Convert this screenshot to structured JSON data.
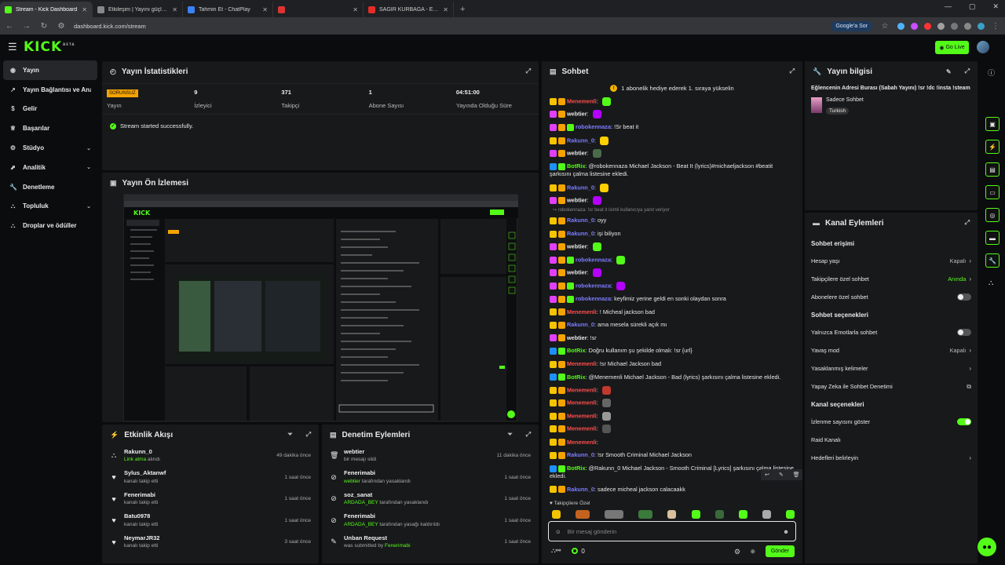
{
  "browser": {
    "tabs": [
      {
        "title": "Stream - Kick Dashboard",
        "color": "#53fc18"
      },
      {
        "title": "Etkileşim | Yayını güçlendir",
        "color": "#888888"
      },
      {
        "title": "Tahmin Et - ChatPlay",
        "color": "#3b82f6"
      },
      {
        "title": "",
        "color": "#d33"
      },
      {
        "title": "SAĞIR KURBAĞA - EĞLENCELİ V",
        "color": "#e52d27"
      }
    ],
    "url": "dashboard.kick.com/stream",
    "google_label": "Google'a Sor"
  },
  "topbar": {
    "logo": "KICK",
    "logo_sup": "BETA",
    "go_live": "Go Live"
  },
  "sidebar": {
    "items": [
      {
        "label": "Yayın",
        "icon": "home-icon",
        "chev": ""
      },
      {
        "label": "Yayın Bağlantısı ve Anahtarı",
        "icon": "link-icon",
        "chev": ""
      },
      {
        "label": "Gelir",
        "icon": "money-icon",
        "chev": ""
      },
      {
        "label": "Başarılar",
        "icon": "trophy-icon",
        "chev": ""
      },
      {
        "label": "Stüdyo",
        "icon": "settings-icon",
        "chev": "⌄"
      },
      {
        "label": "Analitik",
        "icon": "chart-icon",
        "chev": "⌄"
      },
      {
        "label": "Denetleme",
        "icon": "wrench-icon",
        "chev": ""
      },
      {
        "label": "Topluluk",
        "icon": "people-icon",
        "chev": "⌄"
      },
      {
        "label": "Droplar ve ödüller",
        "icon": "gift-icon",
        "chev": ""
      }
    ]
  },
  "stats_panel": {
    "title": "Yayın İstatistikleri",
    "offline_badge": "SORUNSUZ",
    "stats": [
      {
        "value": "",
        "label": "Yayın"
      },
      {
        "value": "9",
        "label": "İzleyici"
      },
      {
        "value": "371",
        "label": "Takipçi"
      },
      {
        "value": "1",
        "label": "Abone Sayısı"
      },
      {
        "value": "04:51:00",
        "label": "Yayında Olduğu Süre"
      }
    ],
    "status_msg": "Stream started successfully."
  },
  "preview_panel": {
    "title": "Yayın Ön İzlemesi"
  },
  "events_panel": {
    "title": "Etkinlik Akışı",
    "items": [
      {
        "name": "Rakunn_0",
        "sub": "Link atma",
        "sub2": " alındı",
        "time": "49 dakika önce",
        "icon": "⛬"
      },
      {
        "name": "Sylus_Aktanwf",
        "sub": "",
        "sub2": "kanalı takip etti",
        "time": "1 saat önce",
        "icon": "♥"
      },
      {
        "name": "Fenerimabi",
        "sub": "",
        "sub2": "kanalı takip etti",
        "time": "1 saat önce",
        "icon": "♥"
      },
      {
        "name": "Batu0978",
        "sub": "",
        "sub2": "kanalı takip etti",
        "time": "1 saat önce",
        "icon": "♥"
      },
      {
        "name": "NeymarJR32",
        "sub": "",
        "sub2": "kanalı takip etti",
        "time": "3 saat önce",
        "icon": "♥"
      }
    ]
  },
  "mod_panel": {
    "title": "Denetim Eylemleri",
    "items": [
      {
        "name": "webtier",
        "sub": "",
        "sub2": "bir mesajı sildi",
        "time": "11 dakika önce",
        "icon": "🗑"
      },
      {
        "name": "Fenerimabi",
        "sub": "webtier",
        "sub2": " tarafından yasaklandı",
        "time": "1 saat önce",
        "icon": "⊘"
      },
      {
        "name": "soz_sanat",
        "sub": "ARDADA_BEY",
        "sub2": " tarafından yasaklandı",
        "time": "1 saat önce",
        "icon": "⊘"
      },
      {
        "name": "Fenerimabi",
        "sub": "ARDADA_BEY",
        "sub2": " tarafından yasağı kaldırıldı",
        "time": "1 saat önce",
        "icon": "⊘"
      },
      {
        "name": "Unban Request",
        "sub": "",
        "sub2": "was submitted by ",
        "sub3": "Fenerimabi",
        "time": "1 saat önce",
        "icon": "✎"
      }
    ]
  },
  "chat_panel": {
    "title": "Sohbet",
    "banner": "1 abonelik hediye ederek 1. sıraya yükselin",
    "reply_note": "robokennaza: !sr beat it isimli kullanıcıya yanıt veriyor",
    "followers_only": "Takipçilere Özel",
    "input_placeholder": "Bir mesaj gönderin",
    "send_label": "Gönder",
    "viewer_count": "0",
    "messages": [
      {
        "user": "Menemenli",
        "color": "#ff4d4d",
        "text": "",
        "badges": [
          "#f5c400",
          "#f5a300"
        ],
        "emote": "#53fc18"
      },
      {
        "user": "webtier",
        "color": "#e8e8e8",
        "text": "",
        "badges": [
          "#e040fb",
          "#f5a300"
        ],
        "emote": "#b400ff"
      },
      {
        "user": "robokennaza",
        "color": "#7c7cff",
        "text": "!Sr beat it",
        "badges": [
          "#e040fb",
          "#f5a300",
          "#53fc18"
        ],
        "emote": ""
      },
      {
        "user": "Rakunn_0",
        "color": "#7c7cff",
        "text": "",
        "badges": [
          "#f5c400",
          "#f5a300"
        ],
        "emote": "#ffd000"
      },
      {
        "user": "webtier",
        "color": "#e8e8e8",
        "text": "",
        "badges": [
          "#e040fb",
          "#f5a300"
        ],
        "emote": "#4a6a4a"
      },
      {
        "user": "BotRix",
        "color": "#53fc18",
        "text": "@robokennaza Michael Jackson - Beat It (lyrics)#michaeljackson #beatit şarkısını çalma listesine ekledi.",
        "badges": [
          "#1e90ff",
          "#53fc18"
        ],
        "emote": "",
        "tall": true
      },
      {
        "user": "Rakunn_0",
        "color": "#7c7cff",
        "text": "",
        "badges": [
          "#f5c400",
          "#f5a300"
        ],
        "emote": "#ffd000"
      },
      {
        "user": "webtier",
        "color": "#e8e8e8",
        "text": "",
        "badges": [
          "#e040fb",
          "#f5a300"
        ],
        "emote": "#b400ff",
        "reply": true
      },
      {
        "user": "Rakunn_0",
        "color": "#7c7cff",
        "text": "oyy",
        "badges": [
          "#f5c400",
          "#f5a300"
        ],
        "emote": ""
      },
      {
        "user": "Rakunn_0",
        "color": "#7c7cff",
        "text": "işi biliyon",
        "badges": [
          "#f5c400",
          "#f5a300"
        ],
        "emote": ""
      },
      {
        "user": "webtier",
        "color": "#e8e8e8",
        "text": "",
        "badges": [
          "#e040fb",
          "#f5a300"
        ],
        "emote": "#53fc18"
      },
      {
        "user": "robokennaza",
        "color": "#7c7cff",
        "text": "",
        "badges": [
          "#e040fb",
          "#f5a300",
          "#53fc18"
        ],
        "emote": "#53fc18"
      },
      {
        "user": "webtier",
        "color": "#e8e8e8",
        "text": "",
        "badges": [
          "#e040fb",
          "#f5a300"
        ],
        "emote": "#b400ff"
      },
      {
        "user": "robokennaza",
        "color": "#7c7cff",
        "text": "",
        "badges": [
          "#e040fb",
          "#f5a300",
          "#53fc18"
        ],
        "emote": "#b400ff"
      },
      {
        "user": "robokennaza",
        "color": "#7c7cff",
        "text": "keyfimiz yerine geldi en sonki olaydan sonra",
        "badges": [
          "#e040fb",
          "#f5a300",
          "#53fc18"
        ],
        "emote": ""
      },
      {
        "user": "Menemenli",
        "color": "#ff4d4d",
        "text": "! Micheal jackson bad",
        "badges": [
          "#f5c400",
          "#f5a300"
        ],
        "emote": ""
      },
      {
        "user": "Rakunn_0",
        "color": "#7c7cff",
        "text": "ama mesela sürekli açık mı",
        "badges": [
          "#f5c400",
          "#f5a300"
        ],
        "emote": ""
      },
      {
        "user": "webtier",
        "color": "#e8e8e8",
        "text": "!sr",
        "badges": [
          "#e040fb",
          "#f5a300"
        ],
        "emote": ""
      },
      {
        "user": "BotRix",
        "color": "#53fc18",
        "text": "Doğru kullanım şu şekilde olmalı: !sr {url}",
        "badges": [
          "#1e90ff",
          "#53fc18"
        ],
        "emote": ""
      },
      {
        "user": "Menemenli",
        "color": "#ff4d4d",
        "text": "!sr Michael Jackson bad",
        "badges": [
          "#f5c400",
          "#f5a300"
        ],
        "emote": ""
      },
      {
        "user": "BotRix",
        "color": "#53fc18",
        "text": "@Menemenli Michael Jackson - Bad (lyrics) şarkısını çalma listesine ekledi.",
        "badges": [
          "#1e90ff",
          "#53fc18"
        ],
        "emote": ""
      },
      {
        "user": "Menemenli",
        "color": "#ff4d4d",
        "text": "",
        "badges": [
          "#f5c400",
          "#f5a300"
        ],
        "emote": "#c0392b"
      },
      {
        "user": "Menemenli",
        "color": "#ff4d4d",
        "text": "",
        "badges": [
          "#f5c400",
          "#f5a300"
        ],
        "emote": "#666666"
      },
      {
        "user": "Menemenli",
        "color": "#ff4d4d",
        "text": "",
        "badges": [
          "#f5c400",
          "#f5a300"
        ],
        "emote": "#999999"
      },
      {
        "user": "Menemenli",
        "color": "#ff4d4d",
        "text": "",
        "badges": [
          "#f5c400",
          "#f5a300"
        ],
        "emote": "#555555"
      },
      {
        "user": "Menemenli",
        "color": "#ff4d4d",
        "text": "",
        "badges": [
          "#f5c400",
          "#f5a300"
        ],
        "emote": ""
      },
      {
        "user": "Rakunn_0",
        "color": "#7c7cff",
        "text": "!sr Smooth Criminal Michael Jackson",
        "badges": [
          "#f5c400",
          "#f5a300"
        ],
        "emote": ""
      },
      {
        "user": "BotRix",
        "color": "#53fc18",
        "text": "@Rakunn_0 Michael Jackson - Smooth Criminal [Lyrics] şarkısını çalma listesine ekledi.",
        "badges": [
          "#1e90ff",
          "#53fc18"
        ],
        "emote": "",
        "tall": true
      },
      {
        "user": "Rakunn_0",
        "color": "#7c7cff",
        "text": "sadece micheal jackson calacaakk",
        "badges": [
          "#f5c400",
          "#f5a300"
        ],
        "emote": ""
      }
    ]
  },
  "info_panel": {
    "title": "Yayın bilgisi",
    "stream_title": "Eğlencenin Adresi Burası (Sabah Yayını) !sr !dc !insta !steam",
    "category": "Sadece Sohbet",
    "tag": "Turkish"
  },
  "actions_panel": {
    "title": "Kanal Eylemleri",
    "sections": [
      {
        "header": "Sohbet erişimi",
        "rows": [
          {
            "label": "Hesap yaşı",
            "value": "Kapalı",
            "kind": "chev"
          },
          {
            "label": "Takipçilere özel sohbet",
            "value": "Anında",
            "kind": "chev-green"
          },
          {
            "label": "Abonelere özel sohbet",
            "value": "",
            "kind": "toggle-off"
          }
        ]
      },
      {
        "header": "Sohbet seçenekleri",
        "rows": [
          {
            "label": "Yalnızca Emotlarla sohbet",
            "value": "",
            "kind": "toggle-off"
          },
          {
            "label": "Yavaş mod",
            "value": "Kapalı",
            "kind": "chev"
          },
          {
            "label": "Yasaklanmış kelimeler",
            "value": "",
            "kind": "chev"
          },
          {
            "label": "Yapay Zeka ile Sohbet Denetimi",
            "value": "",
            "kind": "ext"
          }
        ]
      },
      {
        "header": "Kanal seçenekleri",
        "rows": [
          {
            "label": "İzlenme sayısını göster",
            "value": "",
            "kind": "toggle-on"
          },
          {
            "label": "Raid Kanalı",
            "value": "",
            "kind": "none"
          },
          {
            "label": "Hedefleri belirleyin",
            "value": "",
            "kind": "chev"
          }
        ]
      }
    ]
  }
}
